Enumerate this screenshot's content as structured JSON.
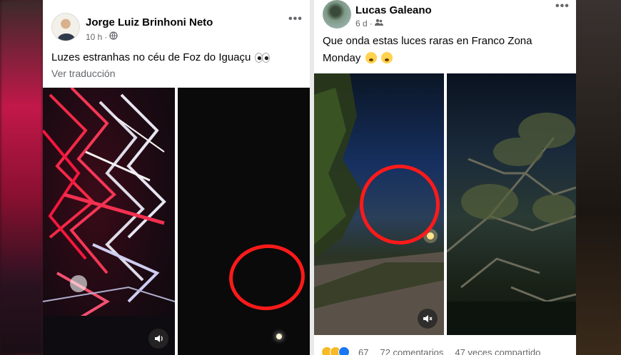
{
  "left_post": {
    "author": "Jorge Luiz Brinhoni Neto",
    "time": "10 h",
    "audience_icon": "globe-icon",
    "text": "Luzes estranhas no céu de Foz do Iguaçu",
    "translate_label": "Ver traducción",
    "more_label": "•••"
  },
  "right_post": {
    "author": "Lucas Galeano",
    "time": "6 d",
    "audience_icon": "friends-icon",
    "text_line1": "Que onda estas luces raras en Franco Zona",
    "text_line2": "Monday",
    "more_label": "•••",
    "reaction_count": "67",
    "comments": "72 comentarios",
    "shares": "47 veces compartido"
  },
  "colors": {
    "annotation_red": "#ff1a1a",
    "text_primary": "#050505",
    "text_secondary": "#65676b"
  }
}
